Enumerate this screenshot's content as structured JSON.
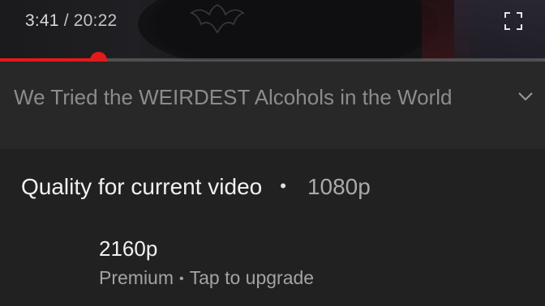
{
  "player": {
    "current_time": "3:41",
    "separator": " / ",
    "duration": "20:22",
    "progress_fraction": 0.18,
    "accent_color": "#e51a1a",
    "fullscreen_icon": "fullscreen-icon"
  },
  "video": {
    "title": "We Tried the WEIRDEST Alcohols in the World",
    "expand_icon": "chevron-down-icon"
  },
  "quality_sheet": {
    "header_label": "Quality for current video",
    "separator": "•",
    "current_value": "1080p",
    "options": [
      {
        "label": "2160p",
        "sub_primary": "Premium",
        "sub_separator": "•",
        "sub_secondary": "Tap to upgrade"
      }
    ]
  }
}
